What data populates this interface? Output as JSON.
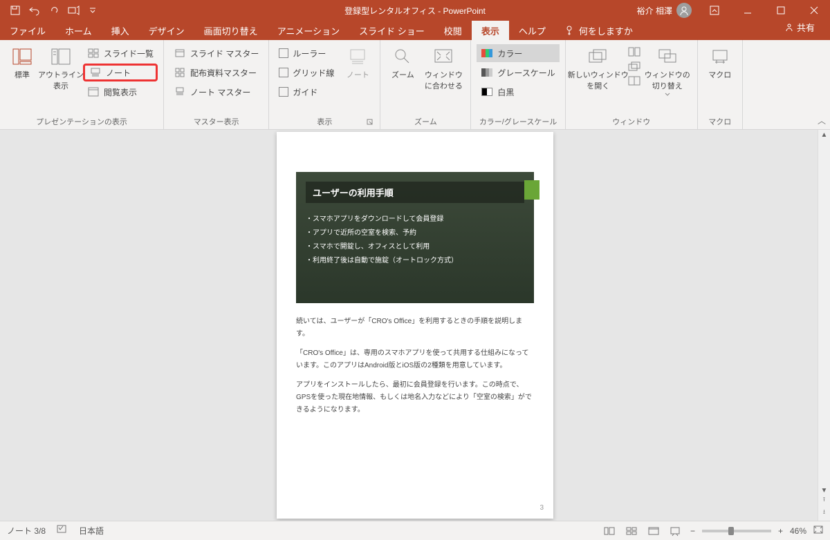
{
  "title": "登録型レンタルオフィス - PowerPoint",
  "user_name": "裕介 相澤",
  "tabs": {
    "file": "ファイル",
    "home": "ホーム",
    "insert": "挿入",
    "design": "デザイン",
    "transitions": "画面切り替え",
    "animations": "アニメーション",
    "slideshow": "スライド ショー",
    "review": "校閲",
    "view": "表示",
    "help": "ヘルプ",
    "tellme": "何をしますか",
    "share": "共有"
  },
  "ribbon": {
    "presentation_views": {
      "label": "プレゼンテーションの表示",
      "normal": "標準",
      "outline": "アウトライン\n表示",
      "slide_sorter": "スライド一覧",
      "notes_page": "ノート",
      "reading": "閲覧表示"
    },
    "master_views": {
      "label": "マスター表示",
      "slide_master": "スライド マスター",
      "handout_master": "配布資料マスター",
      "notes_master": "ノート マスター"
    },
    "show": {
      "label": "表示",
      "ruler": "ルーラー",
      "gridlines": "グリッド線",
      "guides": "ガイド",
      "notes": "ノート"
    },
    "zoom": {
      "label": "ズーム",
      "zoom": "ズーム",
      "fit": "ウィンドウ\nに合わせる"
    },
    "color_gray": {
      "label": "カラー/グレースケール",
      "color": "カラー",
      "grayscale": "グレースケール",
      "bw": "白黒"
    },
    "window": {
      "label": "ウィンドウ",
      "new_window": "新しいウィンドウ\nを開く",
      "switch": "ウィンドウの\n切り替え"
    },
    "macros": {
      "label": "マクロ",
      "macros": "マクロ"
    }
  },
  "slide": {
    "title": "ユーザーの利用手順",
    "bullets": [
      "スマホアプリをダウンロードして会員登録",
      "アプリで近所の空室を検索、予約",
      "スマホで開錠し、オフィスとして利用",
      "利用終了後は自動で施錠（オートロック方式）"
    ],
    "page_number": "3"
  },
  "notes": {
    "p1": "続いては、ユーザーが「CRO's Office」を利用するときの手順を説明します。",
    "p2": "「CRO's Office」は、専用のスマホアプリを使って共用する仕組みになっています。このアプリはAndroid版とiOS版の2種類を用意しています。",
    "p3": "アプリをインストールしたら、最初に会員登録を行います。この時点で、GPSを使った現在地情報、もしくは地名入力などにより「空室の検索」ができるようになります。"
  },
  "status": {
    "page_indicator": "ノート 3/8",
    "language": "日本語",
    "zoom_pct": "46%"
  }
}
